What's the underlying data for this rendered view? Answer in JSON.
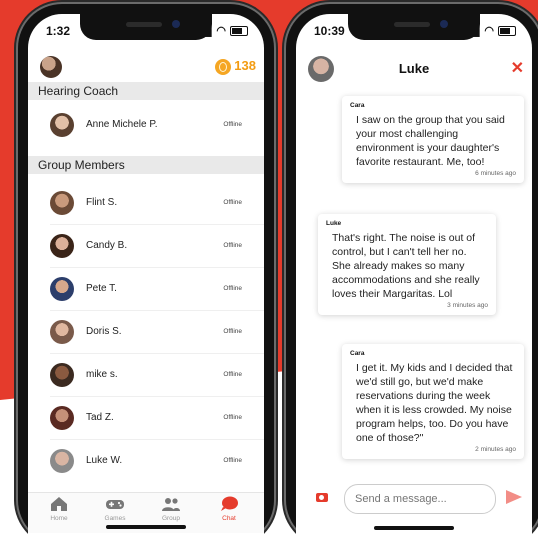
{
  "colors": {
    "accent": "#e53b2c",
    "coin": "#f5a623"
  },
  "left": {
    "status": {
      "time": "1:32"
    },
    "coins": "138",
    "sections": {
      "coach": "Hearing Coach",
      "members": "Group Members"
    },
    "coach": {
      "name": "Anne Michele P.",
      "status": "Offline"
    },
    "members": [
      {
        "name": "Flint S.",
        "status": "Offline"
      },
      {
        "name": "Candy B.",
        "status": "Offline"
      },
      {
        "name": "Pete T.",
        "status": "Offline"
      },
      {
        "name": "Doris S.",
        "status": "Offline"
      },
      {
        "name": "mike s.",
        "status": "Offline"
      },
      {
        "name": "Tad Z.",
        "status": "Offline"
      },
      {
        "name": "Luke W.",
        "status": "Offline"
      }
    ],
    "tabs": [
      {
        "label": "Home",
        "icon": "home-icon"
      },
      {
        "label": "Games",
        "icon": "gamepad-icon"
      },
      {
        "label": "Group",
        "icon": "group-icon"
      },
      {
        "label": "Chat",
        "icon": "chat-icon"
      }
    ]
  },
  "right": {
    "status": {
      "time": "10:39"
    },
    "title": "Luke",
    "messages": [
      {
        "sender": "Cara",
        "text": "I saw on the group that you said your most challenging environment is your daughter's favorite restaurant. Me, too!",
        "time": "6 minutes ago"
      },
      {
        "sender": "Luke",
        "text": "That's right. The noise is out of control, but I can't tell her no. She already makes so many accommodations and she really loves their Margaritas. Lol",
        "time": "3 minutes ago"
      },
      {
        "sender": "Cara",
        "text": "I get it. My kids and I decided that we'd still go, but we'd make reservations during the week when it is less crowded. My noise program helps, too. Do you have one of those?\"",
        "time": "2 minutes ago"
      }
    ],
    "composer": {
      "placeholder": "Send a message..."
    }
  }
}
